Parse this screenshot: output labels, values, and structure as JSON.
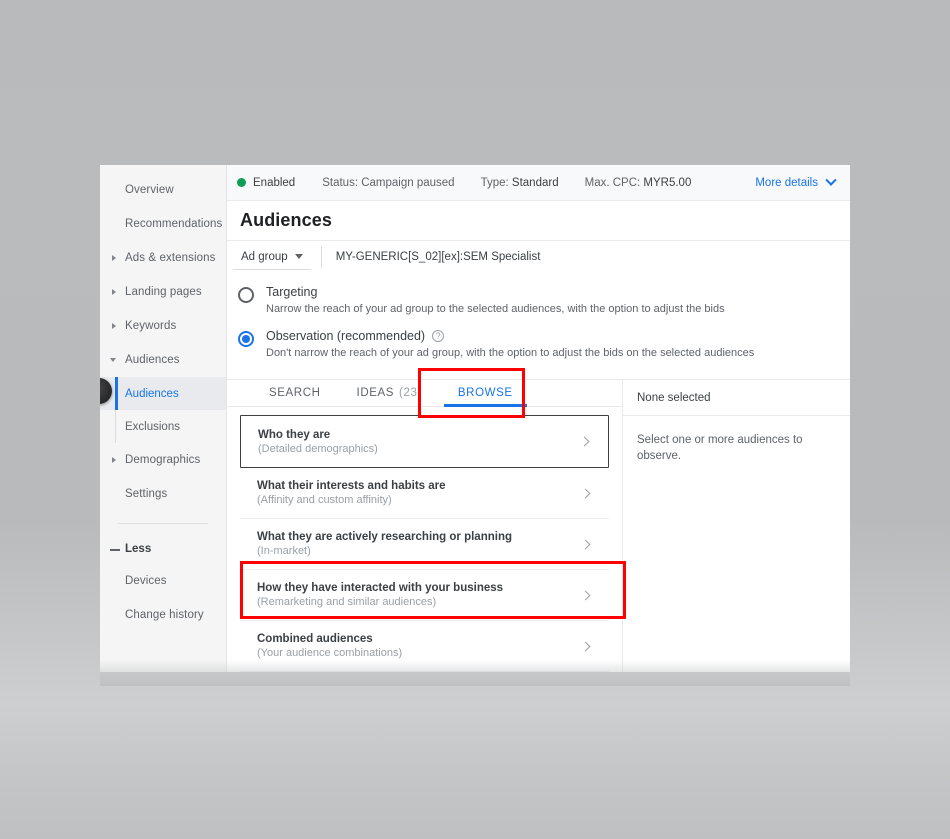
{
  "status_bar": {
    "state_label": "Enabled",
    "state_dot_color": "#0f9d58",
    "cells": [
      {
        "key": "Status:",
        "value": "Campaign paused"
      },
      {
        "key": "Type:",
        "value": "Standard"
      },
      {
        "key": "Max. CPC:",
        "value": "MYR5.00"
      }
    ],
    "more_details_label": "More details",
    "link_color": "#1a73e8"
  },
  "page": {
    "title": "Audiences"
  },
  "adgroup": {
    "selector_label": "Ad group",
    "value": "MY-GENERIC[S_02][ex]:SEM Specialist"
  },
  "sidebar": {
    "items": [
      {
        "label": "Overview",
        "type": "item"
      },
      {
        "label": "Recommendations",
        "type": "item"
      },
      {
        "label": "Ads & extensions",
        "type": "collapsed"
      },
      {
        "label": "Landing pages",
        "type": "collapsed"
      },
      {
        "label": "Keywords",
        "type": "collapsed"
      },
      {
        "label": "Audiences",
        "type": "expanded"
      }
    ],
    "sub_items": [
      {
        "label": "Audiences",
        "selected": true
      },
      {
        "label": "Exclusions",
        "selected": false
      }
    ],
    "items_after": [
      {
        "label": "Demographics",
        "type": "collapsed"
      },
      {
        "label": "Settings",
        "type": "item"
      }
    ],
    "less_label": "Less",
    "bottom_items": [
      {
        "label": "Devices"
      },
      {
        "label": "Change history"
      }
    ]
  },
  "mode_options": [
    {
      "label": "Targeting",
      "description": "Narrow the reach of your ad group to the selected audiences, with the option to adjust the bids",
      "selected": false,
      "has_help": false
    },
    {
      "label": "Observation (recommended)",
      "description": "Don't narrow the reach of your ad group, with the option to adjust the bids on the selected audiences",
      "selected": true,
      "has_help": true,
      "help_glyph": "?"
    }
  ],
  "tabs": [
    {
      "label": "SEARCH",
      "count": "",
      "active": false
    },
    {
      "label": "IDEAS",
      "count": "(23)",
      "active": false
    },
    {
      "label": "BROWSE",
      "count": "",
      "active": true
    }
  ],
  "browse_items": [
    {
      "title": "Who they are",
      "subtitle": "(Detailed demographics)",
      "focused": true
    },
    {
      "title": "What their interests and habits are",
      "subtitle": "(Affinity and custom affinity)",
      "focused": false
    },
    {
      "title": "What they are actively researching or planning",
      "subtitle": "(In-market)",
      "focused": false
    },
    {
      "title": "How they have interacted with your business",
      "subtitle": "(Remarketing and similar audiences)",
      "focused": false
    },
    {
      "title": "Combined audiences",
      "subtitle": "(Your audience combinations)",
      "focused": false
    }
  ],
  "selection_panel": {
    "header": "None selected",
    "hint": "Select one or more audiences to observe."
  },
  "annotations": {
    "color": "#ff0000",
    "boxes": [
      {
        "name": "browse-tab-highlight"
      },
      {
        "name": "remarketing-row-highlight"
      }
    ]
  }
}
